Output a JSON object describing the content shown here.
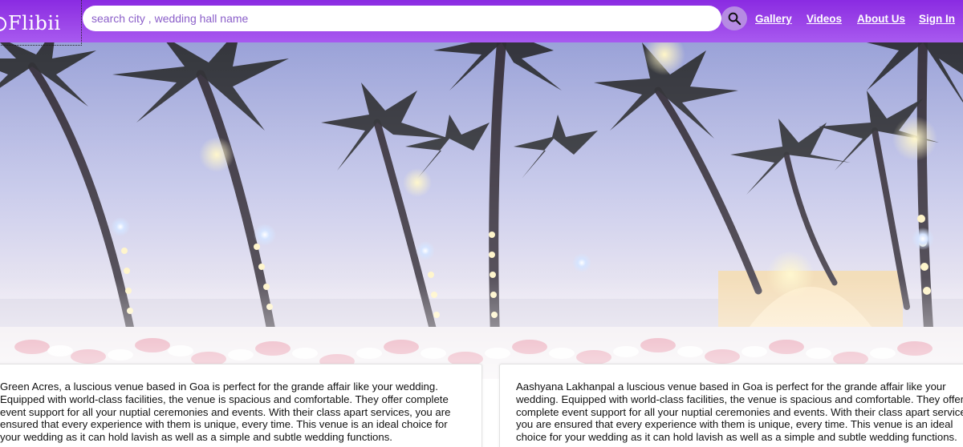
{
  "brand": {
    "name": "Flibii"
  },
  "search": {
    "placeholder": "search city , wedding hall name"
  },
  "nav": {
    "gallery": "Gallery",
    "videos": "Videos",
    "about": "About Us",
    "signin": "Sign In"
  },
  "venues": [
    {
      "description": "Green Acres, a luscious venue based in Goa is perfect for the grande affair like your wedding. Equipped with world-class facilities, the venue is spacious and comfortable. They offer complete event support for all your nuptial ceremonies and events. With their class apart services, you are ensured that every experience with them is unique, every time. This venue is an ideal choice for your wedding as it can hold lavish as well as a simple and subtle wedding functions."
    },
    {
      "description": "Aashyana Lakhanpal a luscious venue based in Goa is perfect for the grande affair like your wedding. Equipped with world-class facilities, the venue is spacious and comfortable. They offer complete event support for all your nuptial ceremonies and events. With their class apart services, you are ensured that every experience with them is unique, every time. This venue is an ideal choice for your wedding as it can hold lavish as well as a simple and subtle wedding functions."
    }
  ],
  "colors": {
    "header_top": "#8a2be2",
    "header_bottom": "#a85af0",
    "search_button": "#b68be3",
    "placeholder": "#8b5fc9"
  },
  "icons": {
    "search": "magnifier-icon",
    "logo": "logo-ring-icon"
  }
}
